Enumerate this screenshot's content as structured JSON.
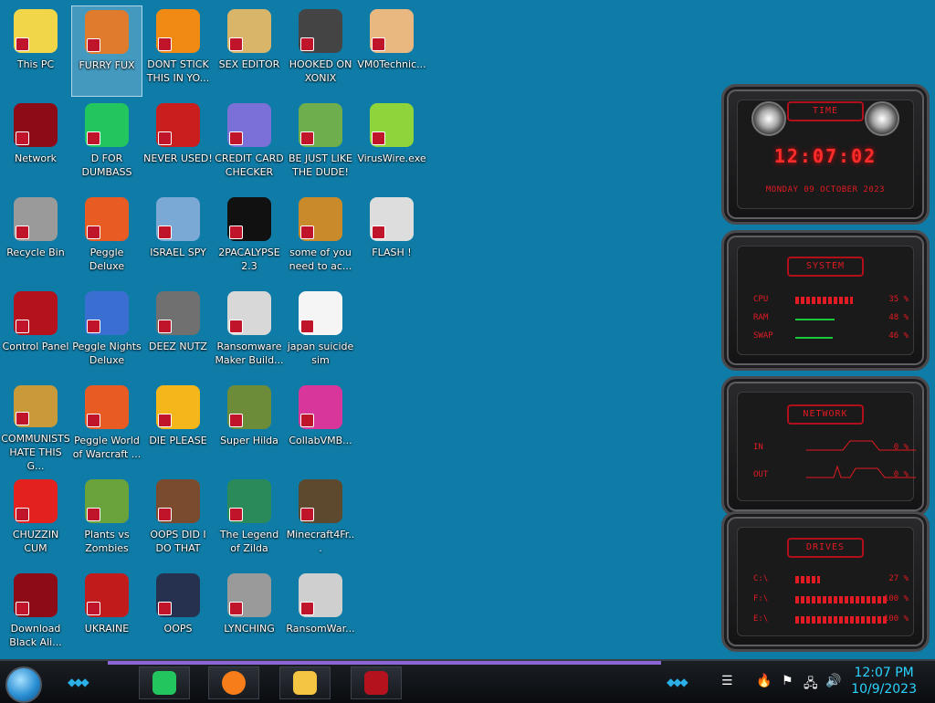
{
  "desktop": {
    "icons": [
      {
        "label": "This PC",
        "icon": "this-pc-icon",
        "color": "#f2d64a"
      },
      {
        "label": "FURRY FUX",
        "icon": "furry-icon",
        "color": "#e07a2c"
      },
      {
        "label": "DONT STICK THIS IN YO...",
        "icon": "vlc-cone-icon",
        "color": "#f08a12"
      },
      {
        "label": "SEX EDITOR",
        "icon": "hxd-icon",
        "color": "#d9b56a"
      },
      {
        "label": "HOOKED ON XONIX",
        "icon": "xonix-icon",
        "color": "#444444"
      },
      {
        "label": "VM0Technic...",
        "icon": "doctor-icon",
        "color": "#e9b880"
      },
      {
        "label": "Network",
        "icon": "network-icon",
        "color": "#8d0b17"
      },
      {
        "label": "D FOR DUMBASS",
        "icon": "discord-icon",
        "color": "#22c55e"
      },
      {
        "label": "NEVER USED!",
        "icon": "devcpp-icon",
        "color": "#c81e1e"
      },
      {
        "label": "CREDIT CARD CHECKER",
        "icon": "credit-card-icon",
        "color": "#7b6fd8"
      },
      {
        "label": "BE JUST LIKE THE DUDE!",
        "icon": "santa-icon",
        "color": "#6fae4d"
      },
      {
        "label": "VirusWire.exe",
        "icon": "lime-icon",
        "color": "#8fd43a"
      },
      {
        "label": "Recycle Bin",
        "icon": "recycle-bin-icon",
        "color": "#9a9a9a"
      },
      {
        "label": "Peggle Deluxe",
        "icon": "peggle-icon",
        "color": "#e85b22"
      },
      {
        "label": "ISRAEL SPY",
        "icon": "network-pc-icon",
        "color": "#7aa9d6"
      },
      {
        "label": "2PACALYPSE 2.3",
        "icon": "terminal-icon",
        "color": "#111111"
      },
      {
        "label": "some of you need to ac...",
        "icon": "dog-icon",
        "color": "#c98a2b"
      },
      {
        "label": "FLASH !",
        "icon": "flash-icon",
        "color": "#dddddd"
      },
      {
        "label": "Control Panel",
        "icon": "control-panel-icon",
        "color": "#b4121c"
      },
      {
        "label": "Peggle Nights Deluxe",
        "icon": "peggle-nights-icon",
        "color": "#3a6fd1"
      },
      {
        "label": "DEEZ NUTZ",
        "icon": "stack-icon",
        "color": "#707070"
      },
      {
        "label": "Ransomware Maker Build...",
        "icon": "window-icon",
        "color": "#d8d8d8"
      },
      {
        "label": "japan suicide sim",
        "icon": "arrows-icon",
        "color": "#f5f5f5"
      },
      {
        "label": "",
        "icon": "",
        "color": ""
      },
      {
        "label": "COMMUNISTS HATE THIS G...",
        "icon": "money-bag-icon",
        "color": "#c99a3a"
      },
      {
        "label": "Peggle World of Warcraft ...",
        "icon": "peggle-wow-icon",
        "color": "#e85b22"
      },
      {
        "label": "DIE PLEASE",
        "icon": "de-icon",
        "color": "#f4b61a"
      },
      {
        "label": "Super Hilda",
        "icon": "pixel-cat-icon",
        "color": "#6c8c3a"
      },
      {
        "label": "CollabVMB...",
        "icon": "collab-icon",
        "color": "#d8369a"
      },
      {
        "label": "",
        "icon": "",
        "color": ""
      },
      {
        "label": "CHUZZIN CUM",
        "icon": "chuzzle-icon",
        "color": "#e3221f"
      },
      {
        "label": "Plants vs Zombies",
        "icon": "pvz-icon",
        "color": "#6aa33b"
      },
      {
        "label": "OOPS DID I DO THAT",
        "icon": "portrait-icon",
        "color": "#7a4b2c"
      },
      {
        "label": "The Legend of Zilda",
        "icon": "pixel-hero-icon",
        "color": "#2a8a5a"
      },
      {
        "label": "Minecraft4Fr...",
        "icon": "grass-block-icon",
        "color": "#5d4a2e"
      },
      {
        "label": "",
        "icon": "",
        "color": ""
      },
      {
        "label": "Download Black Ali...",
        "icon": "alien-ball-icon",
        "color": "#8d0b17"
      },
      {
        "label": "UKRAINE",
        "icon": "radiation-icon",
        "color": "#c21b1b"
      },
      {
        "label": "OOPS",
        "icon": "book-icon",
        "color": "#26314f"
      },
      {
        "label": "LYNCHING",
        "icon": "noose-icon",
        "color": "#9a9a9a"
      },
      {
        "label": "RansomWar...",
        "icon": "skull-icon",
        "color": "#cfcfcf"
      }
    ]
  },
  "gadget": {
    "time_title": "TIME",
    "time": "12:07:02",
    "date": "MONDAY 09 OCTOBER 2023",
    "system_title": "SYSTEM",
    "cpu_label": "CPU",
    "cpu_value": "35 %",
    "cpu_fraction": 0.35,
    "ram_label": "RAM",
    "ram_value": "48 %",
    "ram_fraction": 0.48,
    "swap_label": "SWAP",
    "swap_value": "46 %",
    "swap_fraction": 0.46,
    "network_title": "NETWORK",
    "in_label": "IN",
    "in_value": "0 %",
    "out_label": "OUT",
    "out_value": "0 %",
    "drives_title": "DRIVES",
    "drives": [
      {
        "label": "C:\\",
        "value": "27 %",
        "fraction": 0.27
      },
      {
        "label": "F:\\",
        "value": "100 %",
        "fraction": 1.0
      },
      {
        "label": "E:\\",
        "value": "100 %",
        "fraction": 1.0
      }
    ]
  },
  "taskbar": {
    "apps": [
      {
        "name": "discord-icon",
        "color": "#22c55e"
      },
      {
        "name": "firefox-icon",
        "color": "#f77d1a"
      },
      {
        "name": "file-explorer-icon",
        "color": "#f4c542"
      },
      {
        "name": "control-panel-icon",
        "color": "#b4121c"
      }
    ],
    "clock_time": "12:07 PM",
    "clock_date": "10/9/2023"
  }
}
